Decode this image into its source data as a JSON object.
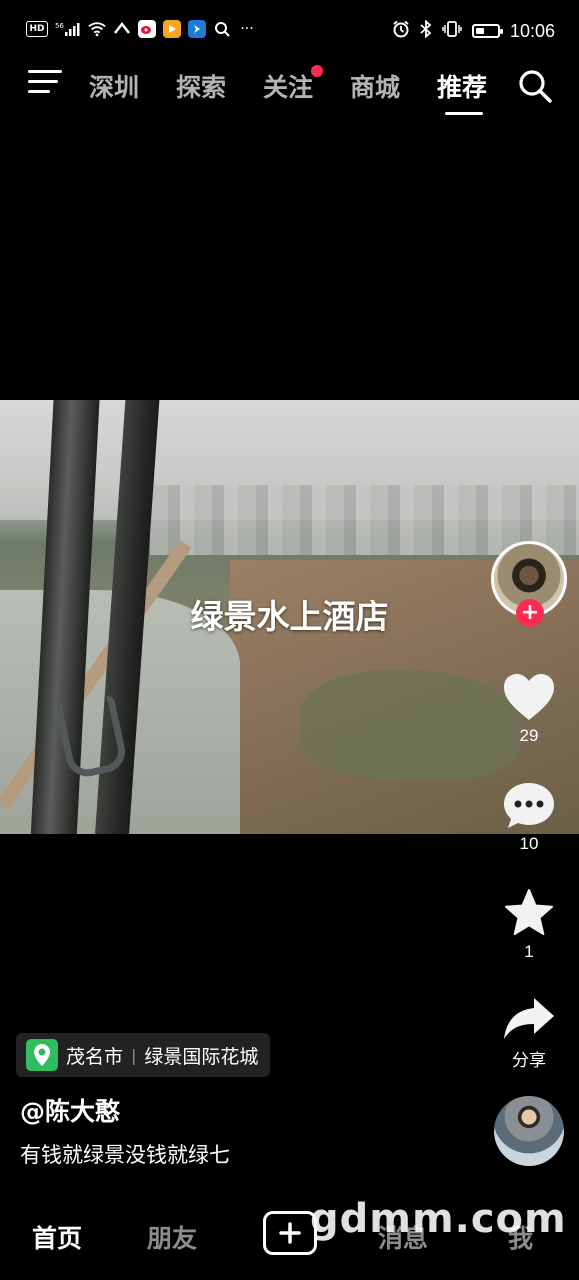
{
  "status_bar": {
    "left_icons": [
      "hd-icon",
      "signal-icon",
      "wifi-icon",
      "weibo-icon",
      "play-icon",
      "app-icon",
      "search-app-icon",
      "more-icon"
    ],
    "signal_label": "56",
    "hd_label": "HD",
    "more_label": "···",
    "time": "10:06",
    "battery_level": 0.4
  },
  "top_nav": {
    "tabs": [
      {
        "label": "深圳"
      },
      {
        "label": "探索"
      },
      {
        "label": "关注",
        "badge": true
      },
      {
        "label": "商城"
      },
      {
        "label": "推荐",
        "active": true
      }
    ]
  },
  "video": {
    "overlay_title": "绿景水上酒店"
  },
  "actions": {
    "follow_label": "+",
    "like_count": "29",
    "comment_count": "10",
    "favorite_count": "1",
    "share_label": "分享"
  },
  "info": {
    "location_city": "茂名市",
    "location_sep": "|",
    "location_name": "绿景国际花城",
    "username": "@陈大憨",
    "caption": "有钱就绿景没钱就绿七"
  },
  "tab_bar": {
    "home": "首页",
    "friends": "朋友",
    "messages": "消息",
    "me": "我"
  },
  "watermark": "gdmm.com",
  "colors": {
    "accent": "#fe2c55",
    "location_green": "#2fbd5f",
    "background": "#000000"
  }
}
